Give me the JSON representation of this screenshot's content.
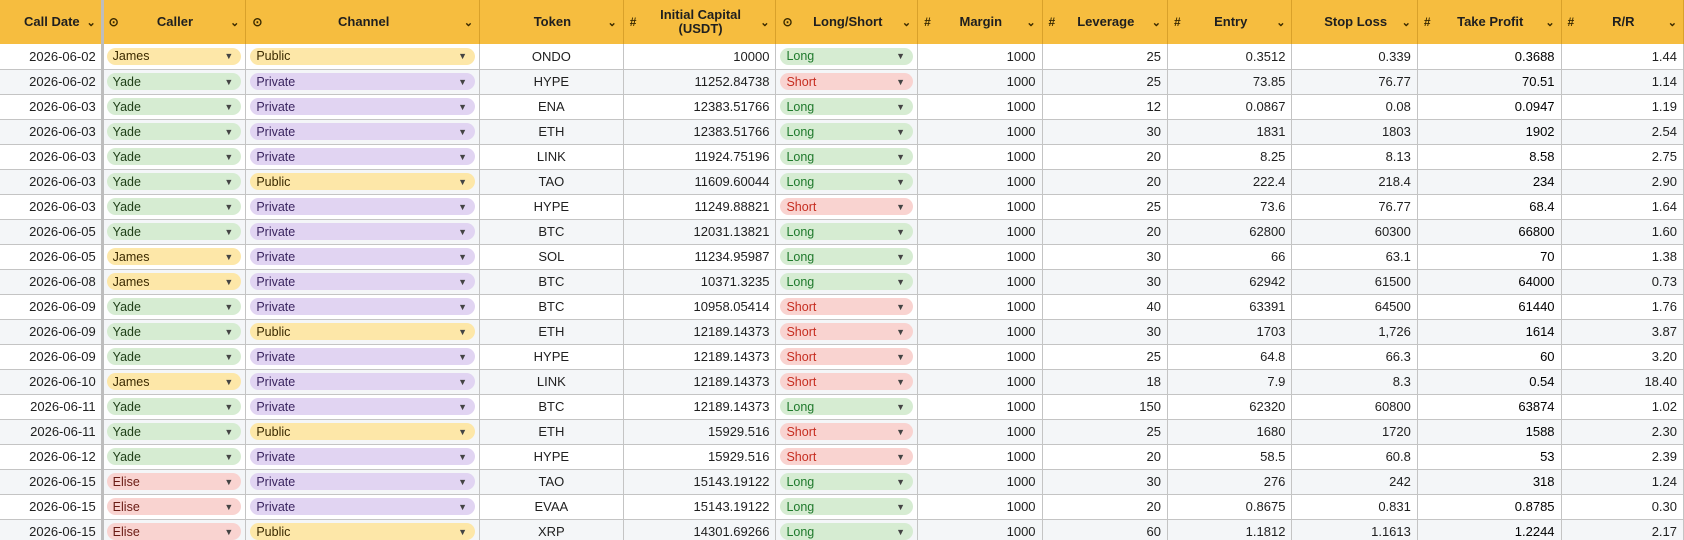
{
  "columns": [
    {
      "type_icon": "",
      "label": "Call Date"
    },
    {
      "type_icon": "⊙",
      "label": "Caller"
    },
    {
      "type_icon": "⊙",
      "label": "Channel"
    },
    {
      "type_icon": "",
      "label": "Token"
    },
    {
      "type_icon": "#",
      "label": "Initial Capital\n(USDT)"
    },
    {
      "type_icon": "⊙",
      "label": "Long/Short"
    },
    {
      "type_icon": "#",
      "label": "Margin"
    },
    {
      "type_icon": "#",
      "label": "Leverage"
    },
    {
      "type_icon": "#",
      "label": "Entry"
    },
    {
      "type_icon": "",
      "label": "Stop Loss"
    },
    {
      "type_icon": "#",
      "label": "Take Profit"
    },
    {
      "type_icon": "#",
      "label": "R/R"
    }
  ],
  "dropdown_glyph": "▼",
  "header_chevron": "⌄",
  "rows": [
    {
      "date": "2026-06-02",
      "caller": "James",
      "channel": "Public",
      "token": "ONDO",
      "capital": "10000",
      "side": "Long",
      "margin": "1000",
      "leverage": "25",
      "entry": "0.3512",
      "stop": "0.339",
      "tp": "0.3688",
      "rr": "1.44"
    },
    {
      "date": "2026-06-02",
      "caller": "Yade",
      "channel": "Private",
      "token": "HYPE",
      "capital": "11252.84738",
      "side": "Short",
      "margin": "1000",
      "leverage": "25",
      "entry": "73.85",
      "stop": "76.77",
      "tp": "70.51",
      "rr": "1.14"
    },
    {
      "date": "2026-06-03",
      "caller": "Yade",
      "channel": "Private",
      "token": "ENA",
      "capital": "12383.51766",
      "side": "Long",
      "margin": "1000",
      "leverage": "12",
      "entry": "0.0867",
      "stop": "0.08",
      "tp": "0.0947",
      "rr": "1.19"
    },
    {
      "date": "2026-06-03",
      "caller": "Yade",
      "channel": "Private",
      "token": "ETH",
      "capital": "12383.51766",
      "side": "Long",
      "margin": "1000",
      "leverage": "30",
      "entry": "1831",
      "stop": "1803",
      "tp": "1902",
      "rr": "2.54"
    },
    {
      "date": "2026-06-03",
      "caller": "Yade",
      "channel": "Private",
      "token": "LINK",
      "capital": "11924.75196",
      "side": "Long",
      "margin": "1000",
      "leverage": "20",
      "entry": "8.25",
      "stop": "8.13",
      "tp": "8.58",
      "rr": "2.75"
    },
    {
      "date": "2026-06-03",
      "caller": "Yade",
      "channel": "Public",
      "token": "TAO",
      "capital": "11609.60044",
      "side": "Long",
      "margin": "1000",
      "leverage": "20",
      "entry": "222.4",
      "stop": "218.4",
      "tp": "234",
      "rr": "2.90"
    },
    {
      "date": "2026-06-03",
      "caller": "Yade",
      "channel": "Private",
      "token": "HYPE",
      "capital": "11249.88821",
      "side": "Short",
      "margin": "1000",
      "leverage": "25",
      "entry": "73.6",
      "stop": "76.77",
      "tp": "68.4",
      "rr": "1.64"
    },
    {
      "date": "2026-06-05",
      "caller": "Yade",
      "channel": "Private",
      "token": "BTC",
      "capital": "12031.13821",
      "side": "Long",
      "margin": "1000",
      "leverage": "20",
      "entry": "62800",
      "stop": "60300",
      "tp": "66800",
      "rr": "1.60"
    },
    {
      "date": "2026-06-05",
      "caller": "James",
      "channel": "Private",
      "token": "SOL",
      "capital": "11234.95987",
      "side": "Long",
      "margin": "1000",
      "leverage": "30",
      "entry": "66",
      "stop": "63.1",
      "tp": "70",
      "rr": "1.38"
    },
    {
      "date": "2026-06-08",
      "caller": "James",
      "channel": "Private",
      "token": "BTC",
      "capital": "10371.3235",
      "side": "Long",
      "margin": "1000",
      "leverage": "30",
      "entry": "62942",
      "stop": "61500",
      "tp": "64000",
      "rr": "0.73"
    },
    {
      "date": "2026-06-09",
      "caller": "Yade",
      "channel": "Private",
      "token": "BTC",
      "capital": "10958.05414",
      "side": "Short",
      "margin": "1000",
      "leverage": "40",
      "entry": "63391",
      "stop": "64500",
      "tp": "61440",
      "rr": "1.76"
    },
    {
      "date": "2026-06-09",
      "caller": "Yade",
      "channel": "Public",
      "token": "ETH",
      "capital": "12189.14373",
      "side": "Short",
      "margin": "1000",
      "leverage": "30",
      "entry": "1703",
      "stop": "1,726",
      "tp": "1614",
      "rr": "3.87"
    },
    {
      "date": "2026-06-09",
      "caller": "Yade",
      "channel": "Private",
      "token": "HYPE",
      "capital": "12189.14373",
      "side": "Short",
      "margin": "1000",
      "leverage": "25",
      "entry": "64.8",
      "stop": "66.3",
      "tp": "60",
      "rr": "3.20"
    },
    {
      "date": "2026-06-10",
      "caller": "James",
      "channel": "Private",
      "token": "LINK",
      "capital": "12189.14373",
      "side": "Short",
      "margin": "1000",
      "leverage": "18",
      "entry": "7.9",
      "stop": "8.3",
      "tp": "0.54",
      "rr": "18.40"
    },
    {
      "date": "2026-06-11",
      "caller": "Yade",
      "channel": "Private",
      "token": "BTC",
      "capital": "12189.14373",
      "side": "Long",
      "margin": "1000",
      "leverage": "150",
      "entry": "62320",
      "stop": "60800",
      "tp": "63874",
      "rr": "1.02"
    },
    {
      "date": "2026-06-11",
      "caller": "Yade",
      "channel": "Public",
      "token": "ETH",
      "capital": "15929.516",
      "side": "Short",
      "margin": "1000",
      "leverage": "25",
      "entry": "1680",
      "stop": "1720",
      "tp": "1588",
      "rr": "2.30"
    },
    {
      "date": "2026-06-12",
      "caller": "Yade",
      "channel": "Private",
      "token": "HYPE",
      "capital": "15929.516",
      "side": "Short",
      "margin": "1000",
      "leverage": "20",
      "entry": "58.5",
      "stop": "60.8",
      "tp": "53",
      "rr": "2.39"
    },
    {
      "date": "2026-06-15",
      "caller": "Elise",
      "channel": "Private",
      "token": "TAO",
      "capital": "15143.19122",
      "side": "Long",
      "margin": "1000",
      "leverage": "30",
      "entry": "276",
      "stop": "242",
      "tp": "318",
      "rr": "1.24"
    },
    {
      "date": "2026-06-15",
      "caller": "Elise",
      "channel": "Private",
      "token": "EVAA",
      "capital": "15143.19122",
      "side": "Long",
      "margin": "1000",
      "leverage": "20",
      "entry": "0.8675",
      "stop": "0.831",
      "tp": "0.8785",
      "rr": "0.30"
    },
    {
      "date": "2026-06-15",
      "caller": "Elise",
      "channel": "Public",
      "token": "XRP",
      "capital": "14301.69266",
      "side": "Long",
      "margin": "1000",
      "leverage": "60",
      "entry": "1.1812",
      "stop": "1.1613",
      "tp": "1.2244",
      "rr": "2.17"
    }
  ],
  "colors": {
    "header_bg": "#f6bd3f",
    "chip_james": "#fde7a8",
    "chip_yade": "#d6ecd2",
    "chip_elise": "#f9d3d0",
    "chip_private": "#e1d4f2",
    "chip_public": "#fde7a8",
    "long_text": "#1f7a2c",
    "short_text": "#c62d20"
  }
}
